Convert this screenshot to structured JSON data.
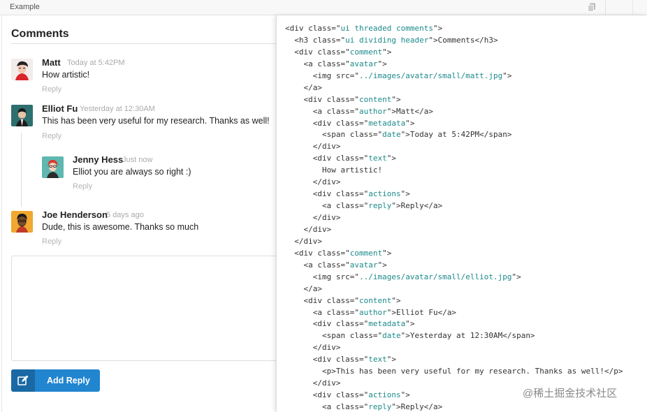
{
  "example_bar": {
    "label": "Example"
  },
  "comments": {
    "header": "Comments",
    "items": [
      {
        "author": "Matt",
        "date": "Today at 5:42PM",
        "text": "How artistic!",
        "reply": "Reply"
      },
      {
        "author": "Elliot Fu",
        "date": "Yesterday at 12:30AM",
        "text": "This has been very useful for my research. Thanks as well!",
        "reply": "Reply"
      },
      {
        "author": "Jenny Hess",
        "date": "Just now",
        "text": "Elliot you are always so right :)",
        "reply": "Reply"
      },
      {
        "author": "Joe Henderson",
        "date": "5 days ago",
        "text": "Dude, this is awesome. Thanks so much",
        "reply": "Reply"
      }
    ]
  },
  "reply_form": {
    "value": "",
    "button_label": "Add Reply"
  },
  "code": {
    "lines": [
      "<div class=\"ui threaded comments\">",
      "  <h3 class=\"ui dividing header\">Comments</h3>",
      "  <div class=\"comment\">",
      "    <a class=\"avatar\">",
      "      <img src=\"../images/avatar/small/matt.jpg\">",
      "    </a>",
      "    <div class=\"content\">",
      "      <a class=\"author\">Matt</a>",
      "      <div class=\"metadata\">",
      "        <span class=\"date\">Today at 5:42PM</span>",
      "      </div>",
      "      <div class=\"text\">",
      "        How artistic!",
      "      </div>",
      "      <div class=\"actions\">",
      "        <a class=\"reply\">Reply</a>",
      "      </div>",
      "    </div>",
      "  </div>",
      "  <div class=\"comment\">",
      "    <a class=\"avatar\">",
      "      <img src=\"../images/avatar/small/elliot.jpg\">",
      "    </a>",
      "    <div class=\"content\">",
      "      <a class=\"author\">Elliot Fu</a>",
      "      <div class=\"metadata\">",
      "        <span class=\"date\">Yesterday at 12:30AM</span>",
      "      </div>",
      "      <div class=\"text\">",
      "        <p>This has been very useful for my research. Thanks as well!</p>",
      "      </div>",
      "      <div class=\"actions\">",
      "        <a class=\"reply\">Reply</a>"
    ]
  },
  "watermark": "@稀土掘金技术社区",
  "colors": {
    "button": "#2185d0",
    "button_icon_box": "#1a69a4",
    "attr_value": "#1d8a8a",
    "reply_link": "#b5b5b5",
    "date": "#aaaaaa"
  },
  "icons": {
    "copy": "copy-icon",
    "edit": "edit-icon"
  }
}
